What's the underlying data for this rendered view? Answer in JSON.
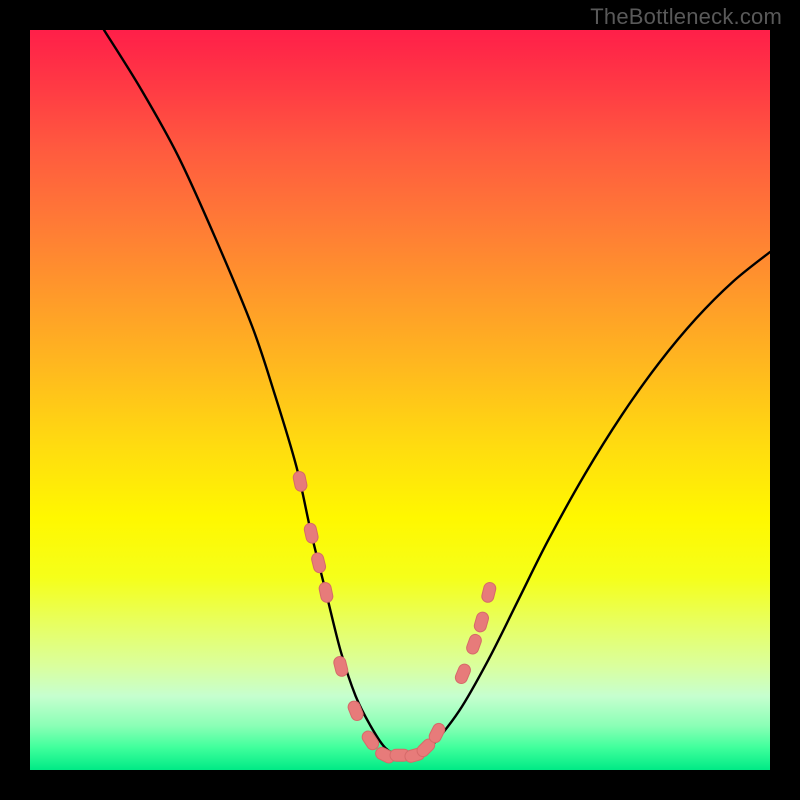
{
  "watermark": "TheBottleneck.com",
  "colors": {
    "frame": "#000000",
    "curve": "#000000",
    "marker_fill": "#e77b7a",
    "marker_stroke": "#d66a69",
    "gradient_top": "#ff1f49",
    "gradient_bottom": "#00ea86"
  },
  "chart_data": {
    "type": "line",
    "title": "",
    "xlabel": "",
    "ylabel": "",
    "xlim": [
      0,
      100
    ],
    "ylim": [
      0,
      100
    ],
    "grid": false,
    "series": [
      {
        "name": "bottleneck-curve",
        "x": [
          10,
          15,
          20,
          25,
          30,
          33,
          36,
          38,
          40,
          42,
          44,
          46,
          48,
          50,
          52,
          54,
          58,
          62,
          66,
          70,
          75,
          80,
          85,
          90,
          95,
          100
        ],
        "values": [
          100,
          92,
          83,
          72,
          60,
          51,
          41,
          32,
          24,
          16,
          10,
          6,
          3,
          2,
          2,
          3,
          8,
          15,
          23,
          31,
          40,
          48,
          55,
          61,
          66,
          70
        ]
      }
    ],
    "markers": {
      "name": "highlight-points",
      "x": [
        36.5,
        38.0,
        39.0,
        40.0,
        42.0,
        44.0,
        46.0,
        48.0,
        50.0,
        52.0,
        53.5,
        55.0,
        58.5,
        60.0,
        61.0,
        62.0
      ],
      "values": [
        39.0,
        32.0,
        28.0,
        24.0,
        14.0,
        8.0,
        4.0,
        2.0,
        2.0,
        2.0,
        3.0,
        5.0,
        13.0,
        17.0,
        20.0,
        24.0
      ]
    }
  }
}
